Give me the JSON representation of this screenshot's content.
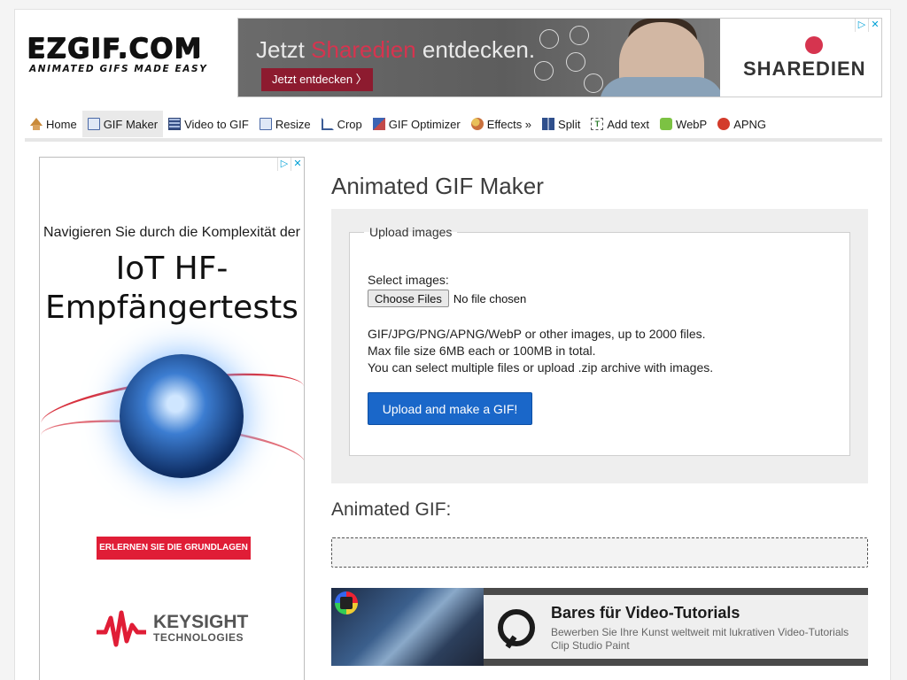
{
  "logo": {
    "main": "EZGIF.COM",
    "tagline": "ANIMATED GIFS MADE EASY"
  },
  "top_ad": {
    "headline_pre": "Jetzt ",
    "headline_brand": "Sharedien",
    "headline_post": " entdecken.",
    "cta": "Jetzt entdecken  〉",
    "brand": "SHAREDIEN",
    "adchoice_icon": "▷",
    "close_icon": "✕"
  },
  "nav": {
    "items": [
      {
        "label": "Home",
        "icon": "home-icon"
      },
      {
        "label": "GIF Maker",
        "icon": "gif-maker-icon",
        "active": true
      },
      {
        "label": "Video to GIF",
        "icon": "film-icon"
      },
      {
        "label": "Resize",
        "icon": "resize-icon"
      },
      {
        "label": "Crop",
        "icon": "crop-icon"
      },
      {
        "label": "GIF Optimizer",
        "icon": "optimizer-icon"
      },
      {
        "label": "Effects »",
        "icon": "palette-icon"
      },
      {
        "label": "Split",
        "icon": "split-icon"
      },
      {
        "label": "Add text",
        "icon": "add-text-icon"
      },
      {
        "label": "WebP",
        "icon": "webp-icon"
      },
      {
        "label": "APNG",
        "icon": "apng-icon"
      }
    ]
  },
  "side_ad": {
    "line1": "Navigieren Sie durch die Komplexität der",
    "line2a": "IoT HF-",
    "line2b": "Empfängertests",
    "cta": "ERLERNEN SIE DIE GRUNDLAGEN ❯❯",
    "company": "KEYSIGHT",
    "company_sub": "TECHNOLOGIES"
  },
  "main": {
    "title": "Animated GIF Maker",
    "fieldset_legend": "Upload images",
    "select_label": "Select images:",
    "choose_button": "Choose Files",
    "no_file": "No file chosen",
    "info_lines": [
      "GIF/JPG/PNG/APNG/WebP or other images, up to 2000 files.",
      "Max file size 6MB each or 100MB in total.",
      "You can select multiple files or upload .zip archive with images."
    ],
    "upload_button": "Upload and make a GIF!",
    "result_title": "Animated GIF:"
  },
  "bottom_ad": {
    "title": "Bares für Video-Tutorials",
    "desc": "Bewerben Sie Ihre Kunst weltweit mit lukrativen Video-Tutorials Clip Studio Paint"
  }
}
